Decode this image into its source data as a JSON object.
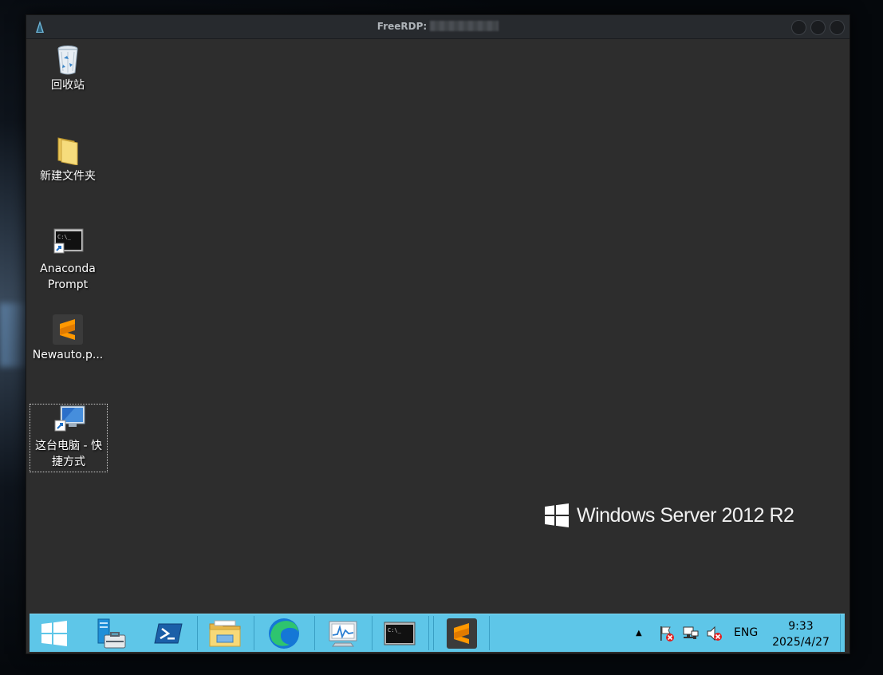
{
  "window": {
    "title_prefix": "FreeRDP:"
  },
  "desktop": {
    "icons": [
      {
        "label": "回收站",
        "icon": "recycle-bin-icon"
      },
      {
        "label": "新建文件夹",
        "icon": "folder-icon"
      },
      {
        "label": "Anaconda\nPrompt",
        "icon": "command-prompt-shortcut-icon"
      },
      {
        "label": "Newauto.p...",
        "icon": "sublime-text-icon"
      },
      {
        "label": "这台电脑 - 快\n捷方式",
        "icon": "this-pc-shortcut-icon"
      }
    ],
    "branding": "Windows Server 2012 R2"
  },
  "taskbar": {
    "buttons": [
      "start-icon",
      "server-manager-icon",
      "powershell-icon",
      "file-explorer-icon",
      "edge-icon",
      "performance-monitor-icon",
      "command-prompt-icon",
      "sublime-text-icon"
    ],
    "tray": {
      "chevron": "▲",
      "ime_label": "ENG",
      "time": "9:33",
      "date": "2025/4/27"
    }
  },
  "colors": {
    "taskbar": "#5ec6e8",
    "desktop": "#2d2d2d",
    "titlebar": "#272a2e"
  }
}
